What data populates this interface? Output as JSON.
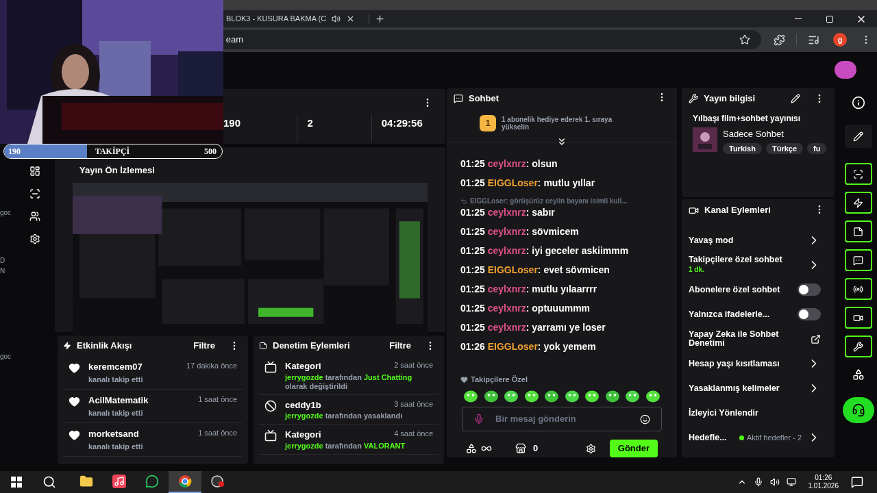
{
  "browser": {
    "tab_title": "BLOK3 - KUSURA BAKMA (C",
    "address": "eam",
    "profile_initial": "g"
  },
  "follower_goal": {
    "current": "190",
    "label": "TAKİPÇİ",
    "target": "500",
    "level": 0.38
  },
  "desktop_fragments": [
    "goc",
    "D",
    "N",
    "goc"
  ],
  "stats": [
    "190",
    "2",
    "04:29:56"
  ],
  "preview": {
    "title": "Yayın Ön İzlemesi"
  },
  "activity": {
    "title": "Etkinlik Akışı",
    "filter": "Filtre",
    "items": [
      {
        "user": "keremcem07",
        "action": "kanalı takip etti",
        "time": "17 dakika önce"
      },
      {
        "user": "AcilMatematik",
        "action": "kanalı takip etti",
        "time": "1 saat önce"
      },
      {
        "user": "morketsand",
        "action": "kanalı takip etti",
        "time": "1 saat önce"
      }
    ]
  },
  "moderation": {
    "title": "Denetim Eylemleri",
    "filter": "Filtre",
    "items": [
      {
        "kind": "category",
        "title": "Kategori",
        "time": "2 saat önce",
        "parts": [
          {
            "text": "jerrygozde",
            "highlight": true
          },
          {
            "text": "tarafından",
            "highlight": false
          },
          {
            "text": "Just Chatting",
            "highlight": true
          },
          {
            "text": "olarak değiştirildi",
            "highlight": false
          }
        ]
      },
      {
        "kind": "ban",
        "title": "ceddy1b",
        "time": "3 saat önce",
        "parts": [
          {
            "text": "jerrygozde",
            "highlight": true
          },
          {
            "text": "tarafından yasaklandı",
            "highlight": false
          }
        ]
      },
      {
        "kind": "category",
        "title": "Kategori",
        "time": "4 saat önce",
        "parts": [
          {
            "text": "jerrygozde",
            "highlight": true
          },
          {
            "text": "tarafından",
            "highlight": false
          },
          {
            "text": "VALORANT",
            "highlight": true
          }
        ]
      }
    ]
  },
  "chat": {
    "title": "Sohbet",
    "pinned": {
      "rank": "1",
      "text": "1 abonelik hediye ederek 1. sıraya yükselin"
    },
    "messages": [
      {
        "kind": "message",
        "time": "01:25",
        "user": "ceylxnrz",
        "color": "#e0508a",
        "text": ": olsun"
      },
      {
        "kind": "message",
        "time": "01:25",
        "user": "EIGGLoser",
        "color": "#f0a030",
        "text": ": mutlu yıllar"
      },
      {
        "kind": "reply",
        "text": "EIGGLoser: görüşürüz ceylin bayanı isimli kull..."
      },
      {
        "kind": "message",
        "time": "01:25",
        "user": "ceylxnrz",
        "color": "#e0508a",
        "text": ": sabır"
      },
      {
        "kind": "message",
        "time": "01:25",
        "user": "ceylxnrz",
        "color": "#e0508a",
        "text": ": sövmicem"
      },
      {
        "kind": "message",
        "time": "01:25",
        "user": "ceylxnrz",
        "color": "#e0508a",
        "text": ": iyi geceler askiimmm"
      },
      {
        "kind": "message",
        "time": "01:25",
        "user": "EIGGLoser",
        "color": "#f0a030",
        "text": ": evet sövmicen"
      },
      {
        "kind": "message",
        "time": "01:25",
        "user": "ceylxnrz",
        "color": "#e0508a",
        "text": ": mutlu yılaarrrr"
      },
      {
        "kind": "message",
        "time": "01:25",
        "user": "ceylxnrz",
        "color": "#e0508a",
        "text": ": optuuummm"
      },
      {
        "kind": "message",
        "time": "01:25",
        "user": "ceylxnrz",
        "color": "#e0508a",
        "text": ": yarramı ye loser"
      },
      {
        "kind": "message",
        "time": "01:26",
        "user": "EIGGLoser",
        "color": "#f0a030",
        "text": ": yok yemem"
      }
    ],
    "emote_label": "Takipçilere Özel",
    "placeholder": "Bir mesaj gönderin",
    "points": "0",
    "send": "Gönder"
  },
  "stream_info": {
    "title": "Yayın bilgisi",
    "stream_title": "Yılbaşı film+sohbet yayınısı",
    "category": "Sadece Sohbet",
    "tags": [
      "Turkish",
      "Türkçe",
      "fu"
    ]
  },
  "channel_actions": {
    "title": "Kanal Eylemleri",
    "items": [
      {
        "kind": "arrow",
        "label": "Yavaş mod"
      },
      {
        "kind": "arrow",
        "label": "Takipçilere özel sohbet",
        "detail": "1 dk."
      },
      {
        "kind": "toggle",
        "label": "Abonelere özel sohbet",
        "on": false
      },
      {
        "kind": "toggle",
        "label": "Yalnızca ifadelerle...",
        "on": false
      },
      {
        "kind": "external",
        "label": "Yapay Zeka ile Sohbet Denetimi"
      },
      {
        "kind": "arrow",
        "label": "Hesap yaşı kısıtlaması"
      },
      {
        "kind": "arrow",
        "label": "Yasaklanmış kelimeler"
      },
      {
        "kind": "plain",
        "label": "İzleyici Yönlendir"
      },
      {
        "kind": "arrow",
        "label": "Hedefle...",
        "detail": "Aktif hedefler - 2"
      }
    ]
  },
  "taskbar": {
    "apps": [
      {
        "kind": "folder",
        "selected": false
      },
      {
        "kind": "music",
        "selected": false
      },
      {
        "kind": "whatsapp",
        "selected": false
      },
      {
        "kind": "chrome",
        "selected": true
      },
      {
        "kind": "recorder",
        "selected": false
      }
    ],
    "time": "01:26",
    "date": "1.01.2026"
  }
}
